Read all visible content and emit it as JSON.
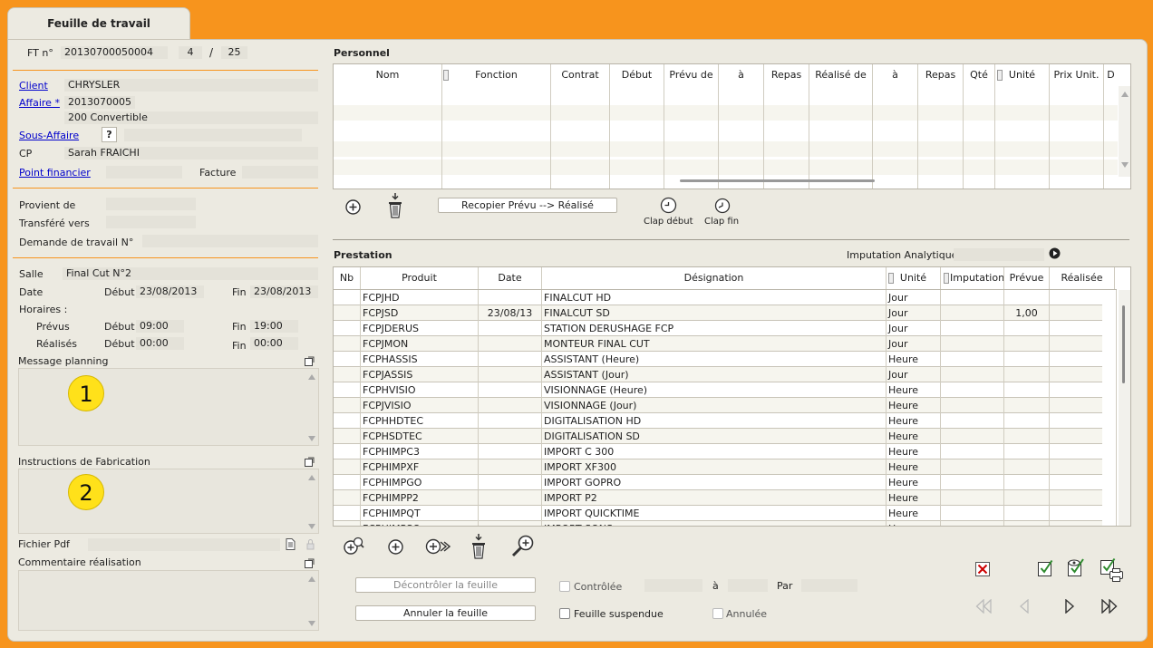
{
  "window": {
    "tab_title": "Feuille de travail"
  },
  "header": {
    "ft_label": "FT n°",
    "ft_number": "20130700050004",
    "page_current": "4",
    "page_sep": "/",
    "page_total": "25"
  },
  "client": {
    "client_label": "Client",
    "client_value": "CHRYSLER",
    "affaire_label": "Affaire *",
    "affaire_value": "2013070005",
    "affaire_desc": "200 Convertible",
    "sous_affaire_label": "Sous-Affaire",
    "sous_affaire_help": "?",
    "cp_label": "CP",
    "cp_value": "Sarah FRAICHI",
    "point_financier_label": "Point financier",
    "facture_label": "Facture"
  },
  "provenance": {
    "provient_label": "Provient de",
    "transfere_label": "Transféré vers",
    "demande_label": "Demande de travail N°"
  },
  "salle": {
    "salle_label": "Salle",
    "salle_value": "Final Cut N°2",
    "date_label": "Date",
    "debut_label": "Début",
    "date_debut": "23/08/2013",
    "fin_label": "Fin",
    "date_fin": "23/08/2013",
    "horaires_label": "Horaires :",
    "prevus_label": "Prévus",
    "prevus_debut": "09:00",
    "prevus_fin": "19:00",
    "realises_label": "Réalisés",
    "realises_debut": "00:00",
    "realises_fin": "00:00"
  },
  "message_planning": {
    "label": "Message planning",
    "badge": "1"
  },
  "instructions": {
    "label": "Instructions de Fabrication",
    "badge": "2"
  },
  "fichier_pdf": {
    "label": "Fichier Pdf"
  },
  "commentaire": {
    "label": "Commentaire réalisation"
  },
  "personnel": {
    "title": "Personnel",
    "columns": [
      "Nom",
      "Fonction",
      "Contrat",
      "Début",
      "Prévu de",
      "à",
      "Repas",
      "Réalisé de",
      "à",
      "Repas",
      "Qté",
      "Unité",
      "Prix Unit.",
      "D"
    ],
    "recopier_label": "Recopier Prévu --> Réalisé",
    "clap_debut_label": "Clap début",
    "clap_fin_label": "Clap fin"
  },
  "prestation": {
    "title": "Prestation",
    "imputation_label": "Imputation Analytique",
    "columns": [
      "Nb",
      "Produit",
      "Date",
      "Désignation",
      "Unité",
      "Imputation",
      "Prévue",
      "Réalisée"
    ],
    "rows": [
      {
        "nb": "",
        "produit": "FCPJHD",
        "date": "",
        "designation": "FINALCUT HD",
        "unite": "Jour",
        "imputation": "",
        "prevue": "",
        "realisee": ""
      },
      {
        "nb": "",
        "produit": "FCPJSD",
        "date": "23/08/13",
        "designation": "FINALCUT SD",
        "unite": "Jour",
        "imputation": "",
        "prevue": "1,00",
        "realisee": ""
      },
      {
        "nb": "",
        "produit": "FCPJDERUS",
        "date": "",
        "designation": "STATION DERUSHAGE FCP",
        "unite": "Jour",
        "imputation": "",
        "prevue": "",
        "realisee": ""
      },
      {
        "nb": "",
        "produit": "FCPJMON",
        "date": "",
        "designation": "MONTEUR FINAL CUT",
        "unite": "Jour",
        "imputation": "",
        "prevue": "",
        "realisee": ""
      },
      {
        "nb": "",
        "produit": "FCPHASSIS",
        "date": "",
        "designation": "ASSISTANT (Heure)",
        "unite": "Heure",
        "imputation": "",
        "prevue": "",
        "realisee": ""
      },
      {
        "nb": "",
        "produit": "FCPJASSIS",
        "date": "",
        "designation": "ASSISTANT (Jour)",
        "unite": "Jour",
        "imputation": "",
        "prevue": "",
        "realisee": ""
      },
      {
        "nb": "",
        "produit": "FCPHVISIO",
        "date": "",
        "designation": "VISIONNAGE (Heure)",
        "unite": "Heure",
        "imputation": "",
        "prevue": "",
        "realisee": ""
      },
      {
        "nb": "",
        "produit": "FCPJVISIO",
        "date": "",
        "designation": "VISIONNAGE (Jour)",
        "unite": "Heure",
        "imputation": "",
        "prevue": "",
        "realisee": ""
      },
      {
        "nb": "",
        "produit": "FCPHHDTEC",
        "date": "",
        "designation": "DIGITALISATION HD",
        "unite": "Heure",
        "imputation": "",
        "prevue": "",
        "realisee": ""
      },
      {
        "nb": "",
        "produit": "FCPHSDTEC",
        "date": "",
        "designation": "DIGITALISATION SD",
        "unite": "Heure",
        "imputation": "",
        "prevue": "",
        "realisee": ""
      },
      {
        "nb": "",
        "produit": "FCPHIMPC3",
        "date": "",
        "designation": "IMPORT C 300",
        "unite": "Heure",
        "imputation": "",
        "prevue": "",
        "realisee": ""
      },
      {
        "nb": "",
        "produit": "FCPHIMPXF",
        "date": "",
        "designation": "IMPORT XF300",
        "unite": "Heure",
        "imputation": "",
        "prevue": "",
        "realisee": ""
      },
      {
        "nb": "",
        "produit": "FCPHIMPGO",
        "date": "",
        "designation": "IMPORT GOPRO",
        "unite": "Heure",
        "imputation": "",
        "prevue": "",
        "realisee": ""
      },
      {
        "nb": "",
        "produit": "FCPHIMPP2",
        "date": "",
        "designation": "IMPORT P2",
        "unite": "Heure",
        "imputation": "",
        "prevue": "",
        "realisee": ""
      },
      {
        "nb": "",
        "produit": "FCPHIMPQT",
        "date": "",
        "designation": "IMPORT QUICKTIME",
        "unite": "Heure",
        "imputation": "",
        "prevue": "",
        "realisee": ""
      },
      {
        "nb": "",
        "produit": "FCPHIMPSO",
        "date": "",
        "designation": "IMPORT SONS",
        "unite": "Heure",
        "imputation": "",
        "prevue": "",
        "realisee": ""
      }
    ]
  },
  "footer": {
    "decontroler_label": "Décontrôler la feuille",
    "annuler_label": "Annuler la feuille",
    "controlee_label": "Contrôlée",
    "a_label": "à",
    "par_label": "Par",
    "suspendue_label": "Feuille suspendue",
    "annulee_label": "Annulée"
  },
  "colors": {
    "frame": "#F7941D",
    "panel": "#ECEAE1",
    "badge": "#FFE11A",
    "link": "#0000CC",
    "check_green": "#2E8B2E",
    "close_red": "#CC0000"
  }
}
